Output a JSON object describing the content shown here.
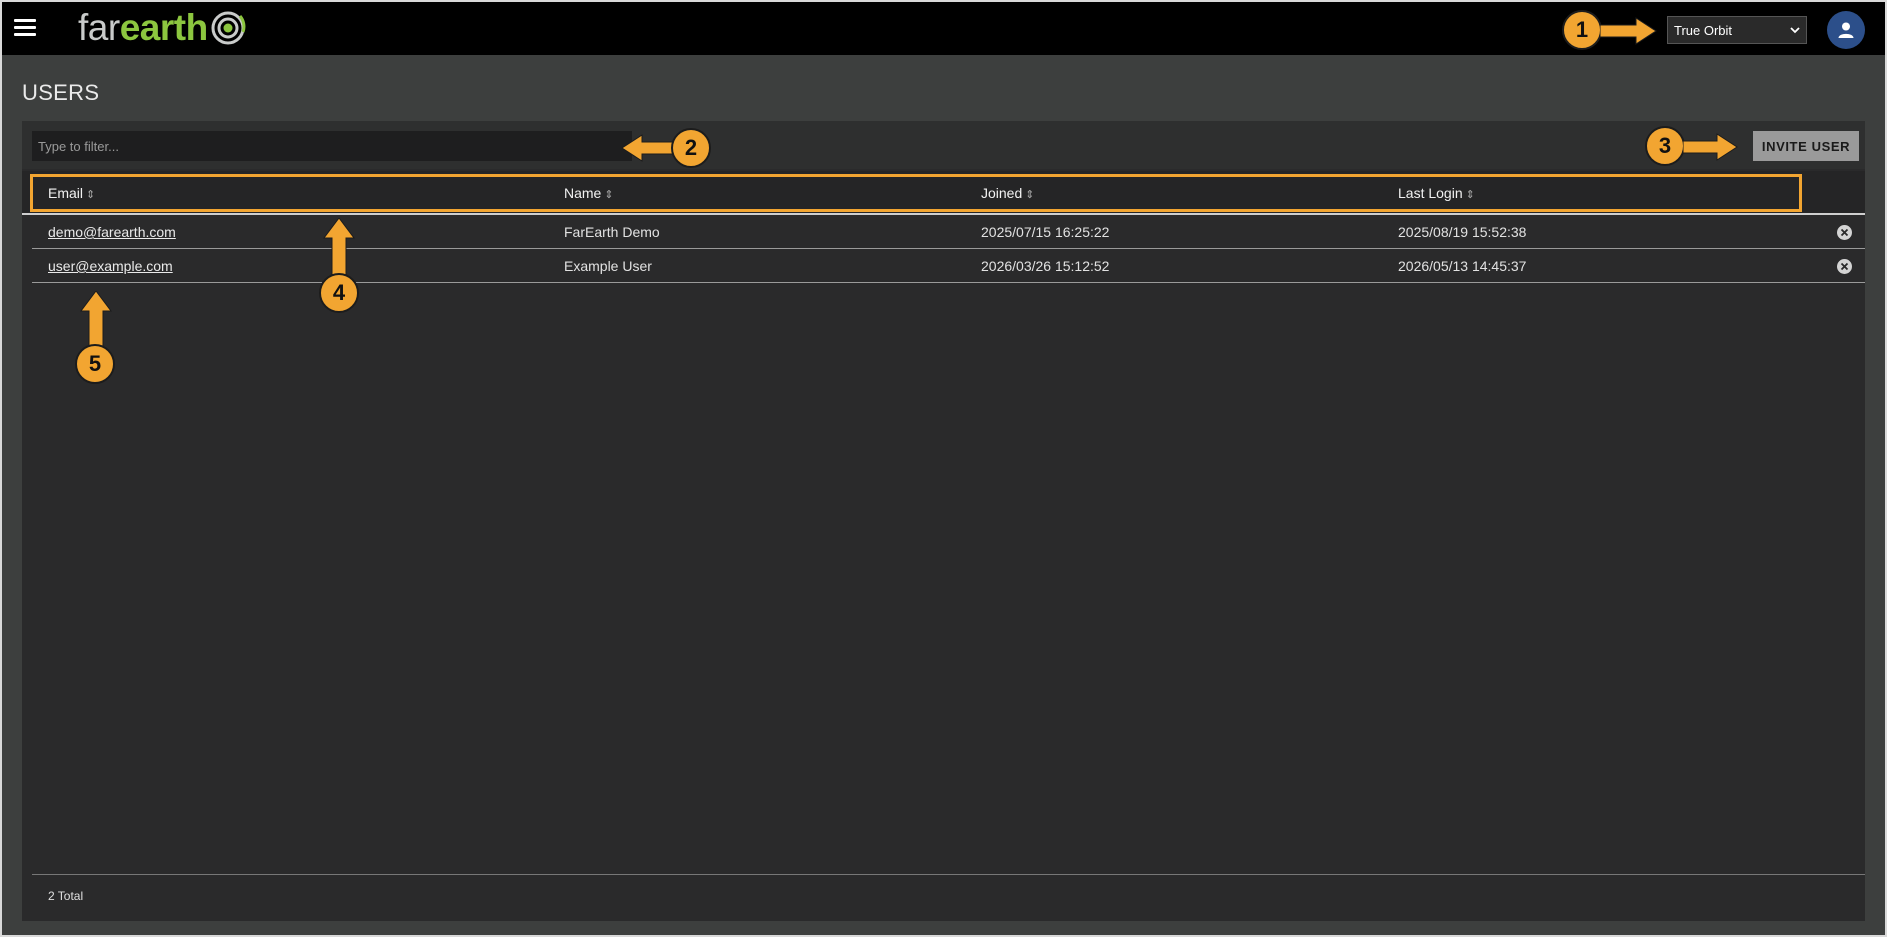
{
  "app": {
    "logo_part1": "far",
    "logo_part2": "earth",
    "page_title": "USERS"
  },
  "header": {
    "org_select_value": "True Orbit"
  },
  "toolbar": {
    "filter_placeholder": "Type to filter...",
    "invite_label": "INVITE USER"
  },
  "table": {
    "columns": [
      "Email",
      "Name",
      "Joined",
      "Last Login"
    ],
    "rows": [
      {
        "email": "demo@farearth.com",
        "name": "FarEarth Demo",
        "joined": "2025/07/15 16:25:22",
        "last_login": "2025/08/19 15:52:38"
      },
      {
        "email": "user@example.com",
        "name": "Example User",
        "joined": "2026/03/26 15:12:52",
        "last_login": "2026/05/13 14:45:37"
      }
    ],
    "total_label": "2 Total"
  },
  "annotations": [
    "1",
    "2",
    "3",
    "4",
    "5"
  ],
  "colors": {
    "accent": "#f2a531",
    "logo_green": "#8cc63f",
    "avatar_bg": "#2c4f8a"
  }
}
